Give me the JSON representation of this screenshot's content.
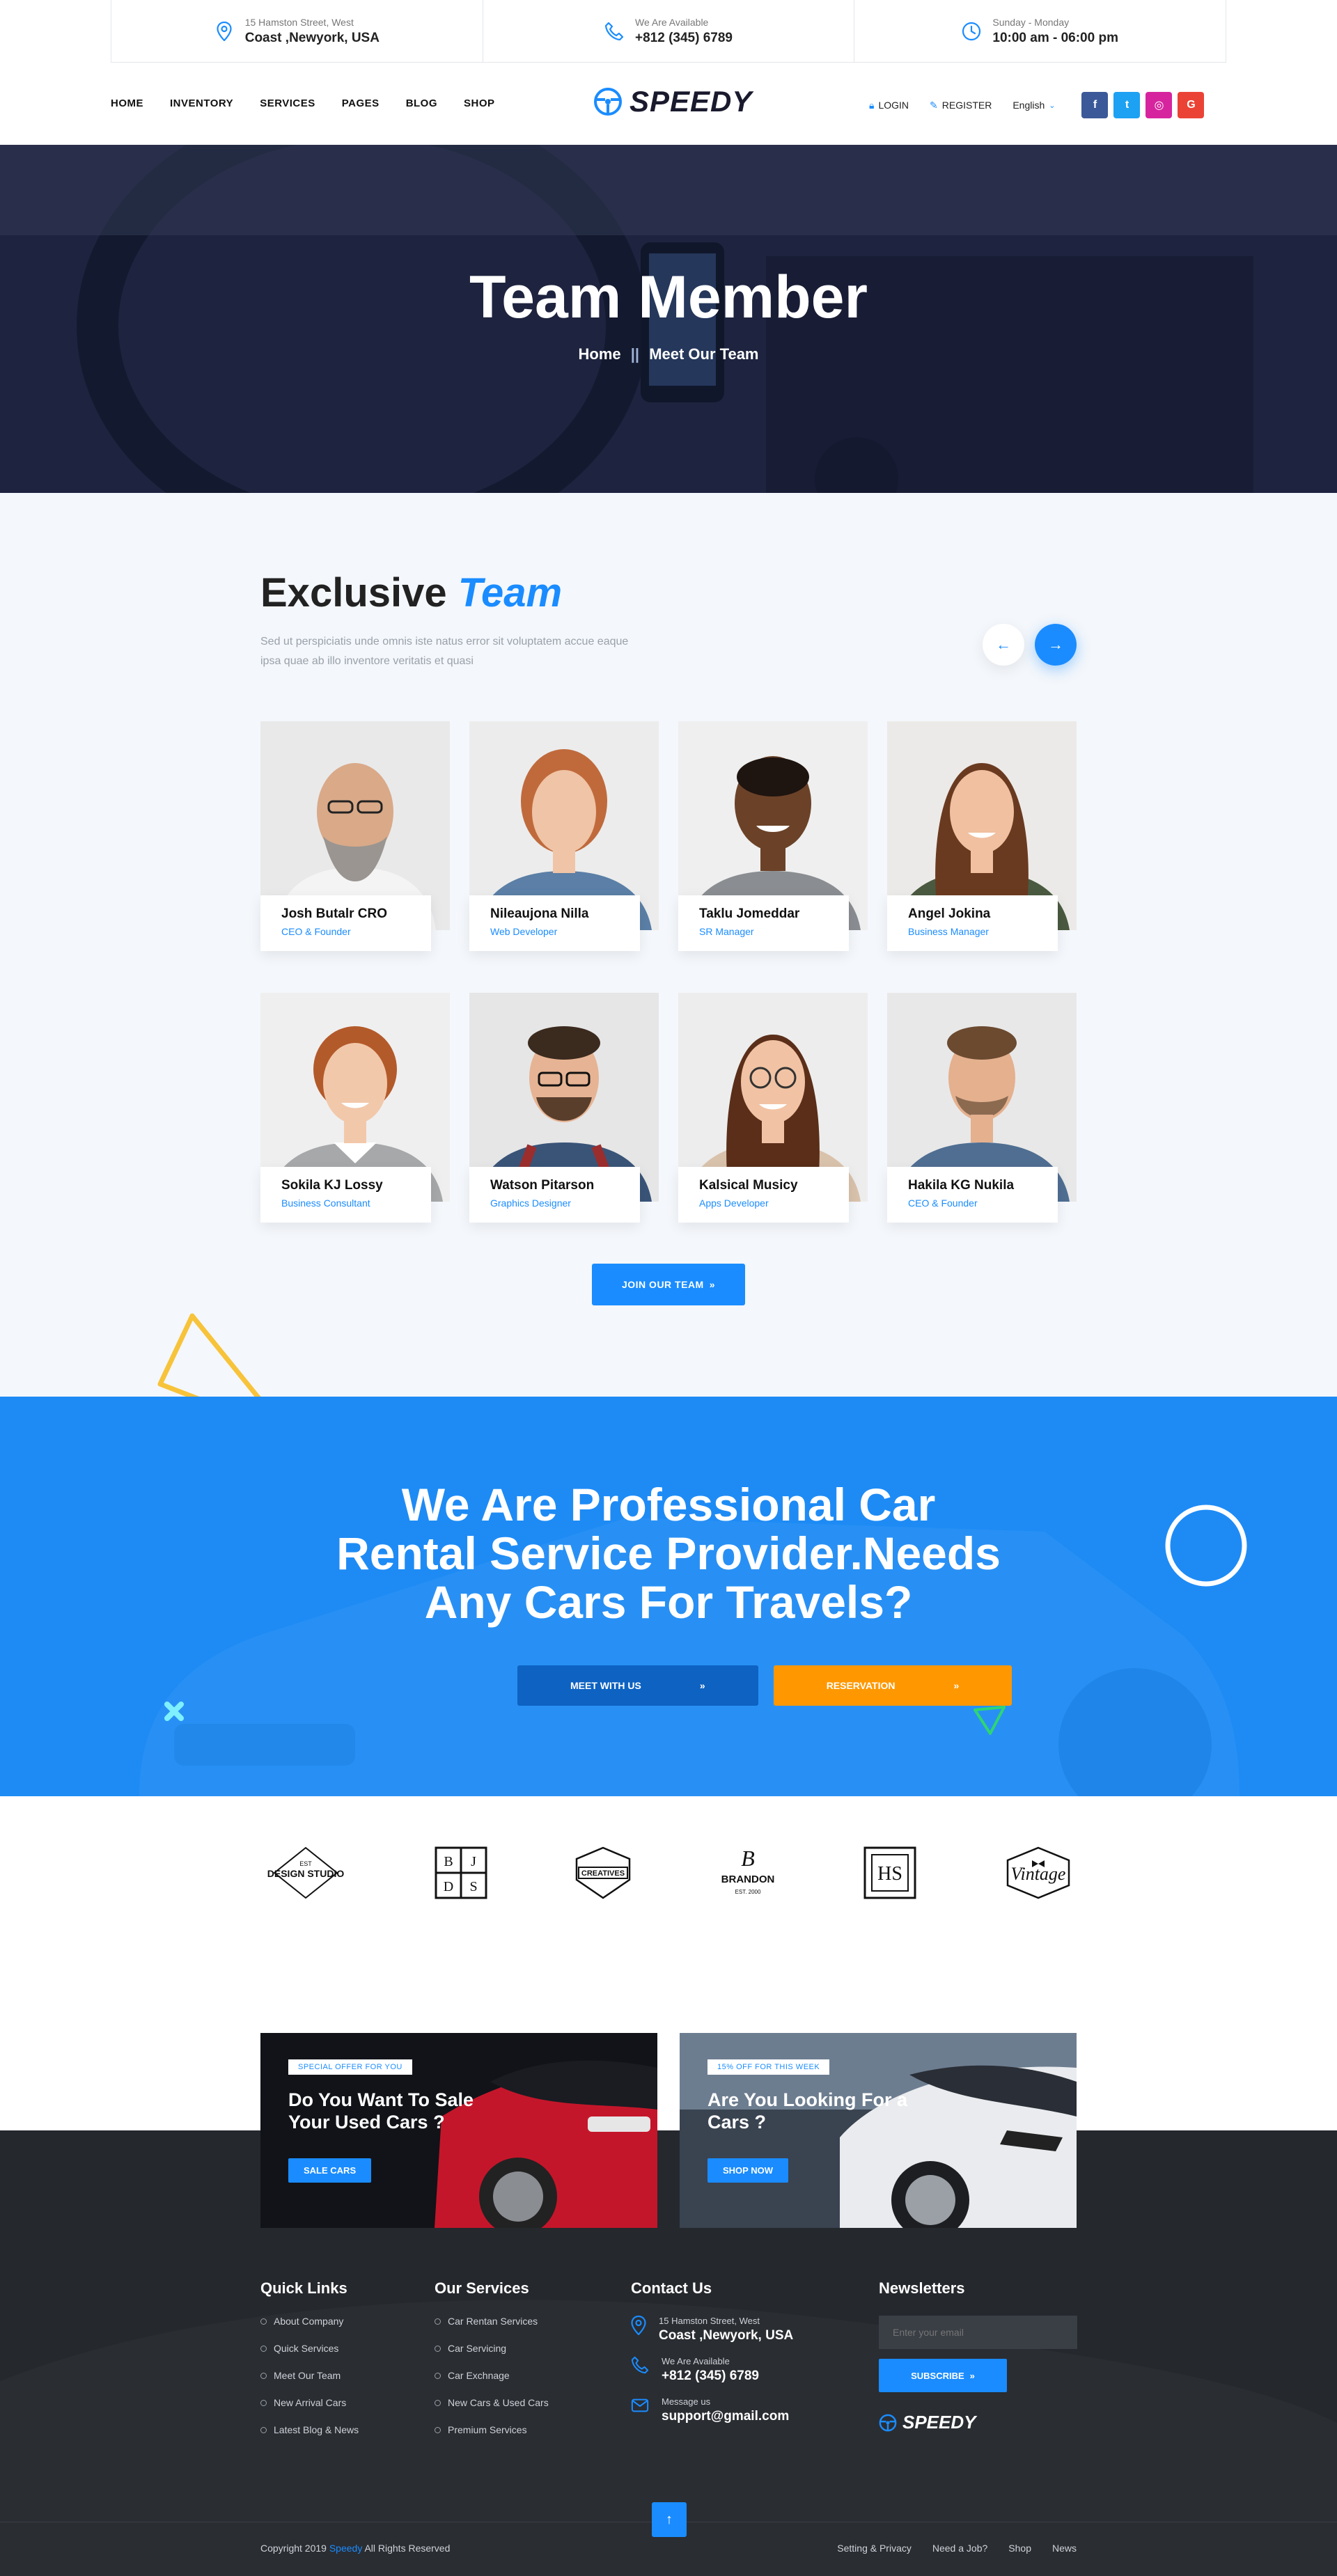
{
  "topbar": {
    "address": {
      "small": "15 Hamston Street, West",
      "big": "Coast ,Newyork, USA"
    },
    "phone": {
      "small": "We Are Available",
      "big": "+812 (345) 6789"
    },
    "hours": {
      "small": "Sunday - Monday",
      "big": "10:00 am - 06:00 pm"
    }
  },
  "nav": {
    "items": [
      "HOME",
      "INVENTORY",
      "SERVICES",
      "PAGES",
      "BLOG",
      "SHOP"
    ],
    "logo": "SPEEDY",
    "login": "LOGIN",
    "register": "REGISTER",
    "language": "English",
    "social": [
      {
        "icon": "facebook-icon",
        "glyph": "f",
        "color": "#3b5998"
      },
      {
        "icon": "twitter-icon",
        "glyph": "t",
        "color": "#1da1f2"
      },
      {
        "icon": "instagram-icon",
        "glyph": "◎",
        "color": "#d6249f"
      },
      {
        "icon": "google-icon",
        "glyph": "G",
        "color": "#ea4335"
      }
    ]
  },
  "hero": {
    "title": "Team Member",
    "crumb_home": "Home",
    "crumb_sep": "||",
    "crumb_current": "Meet Our Team"
  },
  "team": {
    "title_a": "Exclusive",
    "title_b": "Team",
    "desc": "Sed ut perspiciatis unde omnis iste natus error sit voluptatem accue eaque ipsa quae ab illo inventore veritatis et quasi",
    "members": [
      {
        "name": "Josh Butalr CRO",
        "role": "CEO & Founder"
      },
      {
        "name": "Nileaujona Nilla",
        "role": "Web Developer"
      },
      {
        "name": "Taklu Jomeddar",
        "role": "SR Manager"
      },
      {
        "name": "Angel Jokina",
        "role": "Business Manager"
      },
      {
        "name": "Sokila KJ Lossy",
        "role": "Business Consultant"
      },
      {
        "name": "Watson Pitarson",
        "role": "Graphics Designer"
      },
      {
        "name": "Kalsical Musicy",
        "role": "Apps Developer"
      },
      {
        "name": "Hakila KG Nukila",
        "role": "CEO & Founder"
      }
    ],
    "join_label": "JOIN OUR TEAM"
  },
  "cta": {
    "line1": "We Are Professional Car",
    "line2": "Rental Service Provider.Needs",
    "line3": "Any Cars For Travels?",
    "meet_label": "MEET WITH US",
    "reserve_label": "RESERVATION"
  },
  "brands": [
    {
      "top": "EST",
      "name": "DESIGN STUDIO"
    },
    {
      "letters": [
        "B",
        "J",
        "D",
        "S"
      ]
    },
    {
      "name": "CREATIVES"
    },
    {
      "name": "BRANDON",
      "sub": "EST. 2000"
    },
    {
      "name": "HS"
    },
    {
      "name": "Vintage"
    }
  ],
  "promos": [
    {
      "tag": "SPECIAL OFFER FOR YOU",
      "title": "Do You Want To Sale Your Used Cars ?",
      "button": "SALE CARS"
    },
    {
      "tag": "15% OFF FOR THIS WEEK",
      "title": "Are You Looking For a Cars ?",
      "button": "SHOP NOW"
    }
  ],
  "footer": {
    "quick_title": "Quick Links",
    "quick_links": [
      "About Company",
      "Quick Services",
      "Meet Our Team",
      "New Arrival Cars",
      "Latest Blog & News"
    ],
    "services_title": "Our Services",
    "services": [
      "Car Rentan Services",
      "Car Servicing",
      "Car Exchnage",
      "New Cars & Used Cars",
      "Premium Services"
    ],
    "contact_title": "Contact Us",
    "contact": [
      {
        "s": "15 Hamston Street, West",
        "b": "Coast ,Newyork, USA"
      },
      {
        "s": "We Are Available",
        "b": "+812 (345) 6789"
      },
      {
        "s": "Message us",
        "b": "support@gmail.com"
      }
    ],
    "news_title": "Newsletters",
    "email_placeholder": "Enter your email",
    "subscribe_label": "SUBSCRIBE",
    "logo": "SPEEDY",
    "copy_a": "Copyright  2019 ",
    "copy_brand": "Speedy",
    "copy_b": " All Rights Reserved",
    "bottom_links": [
      "Setting & Privacy",
      "Need a Job?",
      "Shop",
      "News"
    ]
  }
}
